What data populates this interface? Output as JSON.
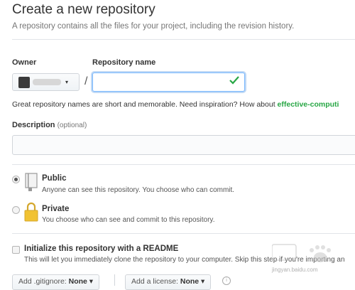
{
  "page": {
    "title": "Create a new repository",
    "subtitle": "A repository contains all the files for your project, including the revision history."
  },
  "owner": {
    "label": "Owner",
    "caret": "▾"
  },
  "separator": "/",
  "repo_name": {
    "label": "Repository name",
    "value": "",
    "placeholder": ""
  },
  "hint": {
    "text": "Great repository names are short and memorable. Need inspiration? How about ",
    "suggestion": "effective-computi"
  },
  "description": {
    "label": "Description",
    "optional": "(optional)",
    "value": ""
  },
  "visibility": {
    "public": {
      "title": "Public",
      "desc": "Anyone can see this repository. You choose who can commit.",
      "selected": true
    },
    "private": {
      "title": "Private",
      "desc": "You choose who can see and commit to this repository.",
      "selected": false
    }
  },
  "readme": {
    "title": "Initialize this repository with a README",
    "desc": "This will let you immediately clone the repository to your computer. Skip this step if you're importing an",
    "checked": false
  },
  "gitignore": {
    "label": "Add .gitignore:",
    "value": "None ▾"
  },
  "license": {
    "label": "Add a license:",
    "value": "None ▾"
  },
  "info_icon": "i",
  "watermark": {
    "sub": "jingyan.baidu.com"
  },
  "colors": {
    "accent_green": "#28a745",
    "focus_blue": "#79b8ff",
    "lock_yellow": "#f1c232"
  }
}
